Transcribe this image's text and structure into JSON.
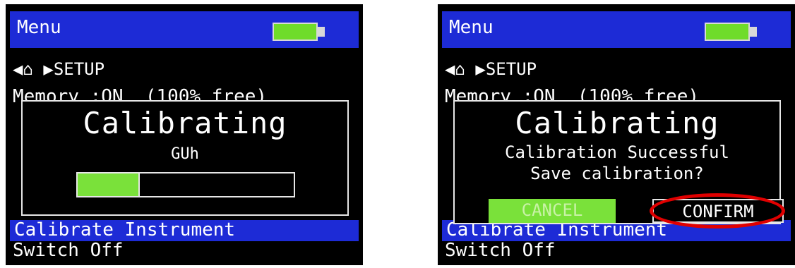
{
  "screens": [
    {
      "menu_title": "Menu",
      "breadcrumb": {
        "left_arrow": "◀",
        "home_icon": "⌂",
        "right_arrow": "▶",
        "label": "SETUP"
      },
      "memory_line": "Memory :ON  (100% free)",
      "highlight_text": "Calibrate Instrument",
      "switch_off": "Switch Off",
      "dialog": {
        "title": "Calibrating",
        "sub": "GUh",
        "progress": 0.28
      }
    },
    {
      "menu_title": "Menu",
      "breadcrumb": {
        "left_arrow": "◀",
        "home_icon": "⌂",
        "right_arrow": "▶",
        "label": "SETUP"
      },
      "memory_line": "Memory :ON  (100% free)",
      "highlight_text": "Calibrate Instrument",
      "switch_off": "Switch Off",
      "dialog": {
        "title": "Calibrating",
        "line1": "Calibration Successful",
        "line2": "Save calibration?",
        "cancel": "CANCEL",
        "confirm": "CONFIRM"
      }
    }
  ],
  "colors": {
    "title_bar": "#1d2bd6",
    "battery": "#6fdc2a",
    "progress": "#7ae13a",
    "highlight_ring": "#e00000"
  }
}
